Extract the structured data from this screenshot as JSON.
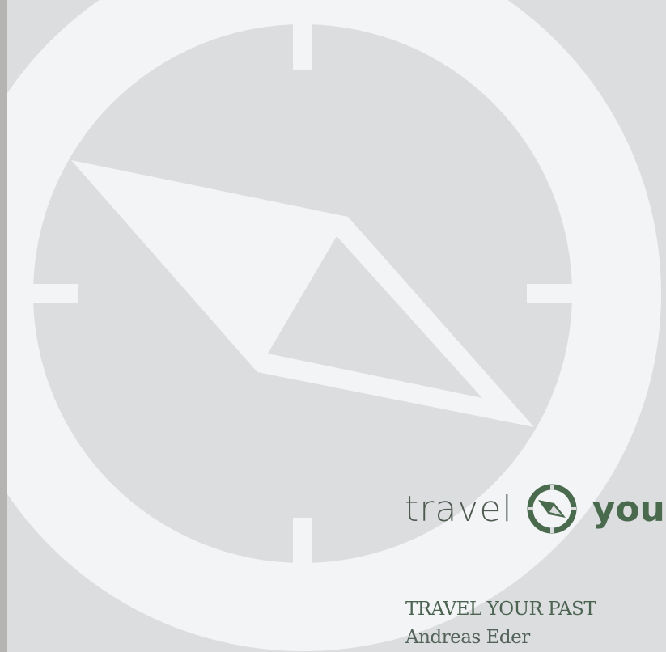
{
  "cover": {
    "logo": {
      "word_travel": "travel",
      "icon": "compass-icon",
      "word_your": "you"
    },
    "title": "TRAVEL YOUR PAST",
    "author": "Andreas Eder"
  },
  "colors": {
    "background": "#dcdddf",
    "compass_watermark": "#f3f4f6",
    "brand_green": "#4a6a4e"
  }
}
